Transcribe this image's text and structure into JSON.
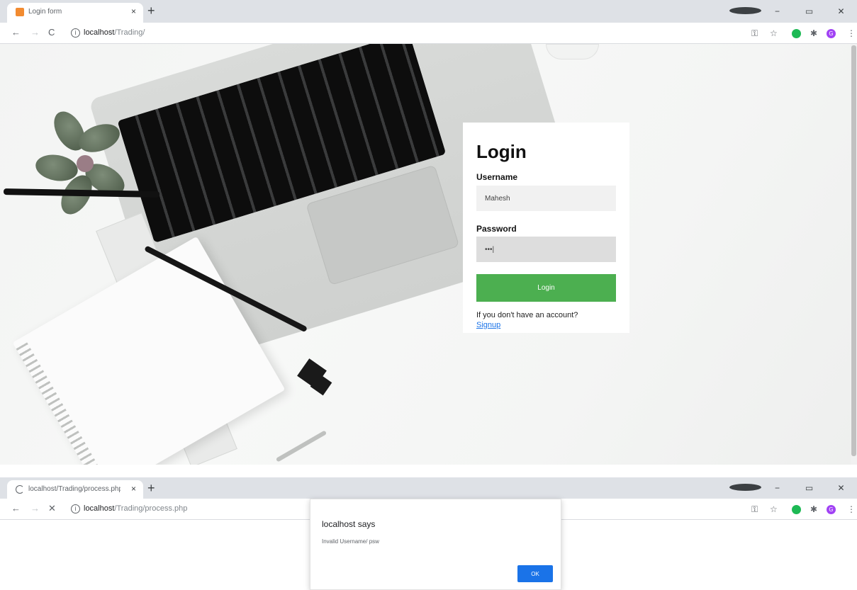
{
  "window1": {
    "tab": {
      "title": "Login form",
      "favicon_color": "#f28b30",
      "close": "×"
    },
    "new_tab": "+",
    "controls": {
      "minimize": "−",
      "maximize": "▭",
      "close": "✕"
    },
    "nav": {
      "back": "←",
      "forward": "→",
      "reload": "C"
    },
    "url": {
      "host": "localhost",
      "path": "/Trading/"
    },
    "extensions": {
      "key": "⚿",
      "star": "☆",
      "puzzle": "✱",
      "profile_initial": "G",
      "menu": "⋮"
    },
    "login": {
      "title": "Login",
      "username_label": "Username",
      "username_value": "Mahesh",
      "password_label": "Password",
      "password_value": "•••|",
      "button": "Login",
      "signup_text": "If you don't have an account?",
      "signup_link": "Signup"
    }
  },
  "window2": {
    "tab": {
      "title": "localhost/Trading/process.php",
      "close": "×"
    },
    "new_tab": "+",
    "controls": {
      "minimize": "−",
      "maximize": "▭",
      "close": "✕"
    },
    "nav": {
      "back": "←",
      "forward": "→",
      "stop": "✕"
    },
    "url": {
      "host": "localhost",
      "path": "/Trading/process.php"
    },
    "extensions": {
      "key": "⚿",
      "star": "☆",
      "puzzle": "✱",
      "profile_initial": "G",
      "menu": "⋮"
    },
    "alert": {
      "title": "localhost says",
      "message": "Invalid Username/ psw",
      "ok": "OK"
    }
  },
  "colors": {
    "login_button": "#4caf50",
    "ok_button": "#1a73e8",
    "link": "#1a73e8",
    "profile": "#a142f4",
    "ext_green": "#1db954"
  }
}
